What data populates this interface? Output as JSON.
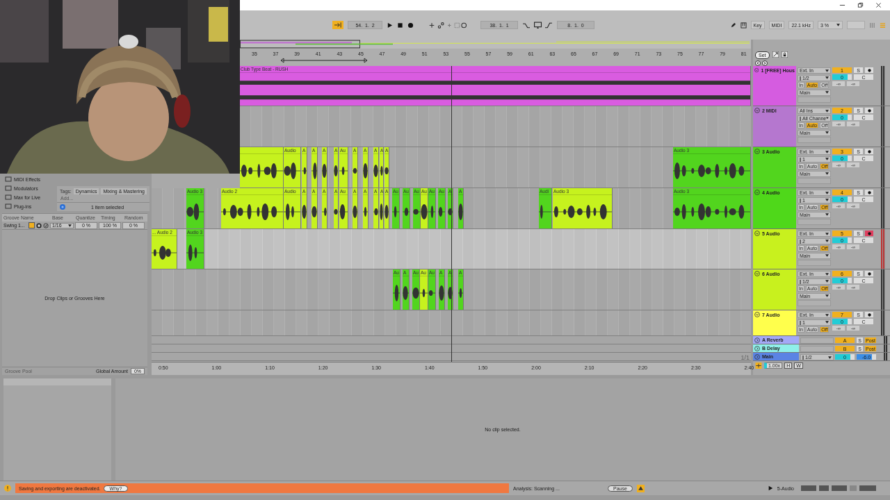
{
  "transport": {
    "follow": true,
    "position": "54.  1.  2",
    "loop_start": "38.  1.  1",
    "loop_length": "8.  1.  0"
  },
  "settings": {
    "key": "Key",
    "midi": "MIDI",
    "sample_rate": "22.1 kHz",
    "cpu": "3 %"
  },
  "ruler": {
    "bars": [
      "35",
      "37",
      "39",
      "41",
      "43",
      "45",
      "47",
      "49",
      "51",
      "53",
      "55",
      "57",
      "59",
      "61",
      "63",
      "65",
      "67",
      "69",
      "71",
      "73",
      "75",
      "77",
      "79",
      "81"
    ],
    "set": "Set"
  },
  "browser": {
    "categories": [
      "MIDI Effects",
      "Modulators",
      "Max for Live",
      "Plug-ins"
    ],
    "tags_label": "Tags:",
    "tags": [
      "Dynamics",
      "Mixing & Mastering"
    ],
    "tag_placeholder": "Add...",
    "selection": "1 item selected"
  },
  "groove_pool": {
    "columns": [
      "Groove Name",
      "Base",
      "Quantize",
      "Timing",
      "Random"
    ],
    "grooves": [
      {
        "name": "Swing 1...",
        "hot_swap": true,
        "base": "1/16",
        "quantize": "0 %",
        "timing": "100 %",
        "random": "0 %"
      }
    ],
    "hint": "Drop Clips or Grooves Here",
    "title": "Groove Pool",
    "global_amount_label": "Global Amount",
    "global_amount": "0%"
  },
  "tracks": [
    {
      "name": "1 [FREE] Hous",
      "color": "#d55ce0",
      "input": "Ext. In",
      "channel": "1/2",
      "monitor": [
        {
          "label": "In",
          "selected": false
        },
        {
          "label": "Auto",
          "selected": true
        },
        {
          "label": "Off",
          "selected": false
        }
      ],
      "output": "Main",
      "number": "1",
      "solo": "S",
      "armed": false,
      "volume": "0",
      "pan": "C",
      "peaks": [
        "-∞",
        "-∞"
      ],
      "clips": [
        {
          "name": "Club Type Beat - RUSH",
          "color": "#d95ce0"
        }
      ]
    },
    {
      "name": "2 MIDI",
      "color": "#b577cf",
      "input": "All Ins",
      "channel": "All Channe",
      "monitor": [
        {
          "label": "In",
          "selected": false
        },
        {
          "label": "Auto",
          "selected": true
        },
        {
          "label": "Off",
          "selected": false
        }
      ],
      "output": "Main",
      "number": "2",
      "solo": "S",
      "armed": false,
      "volume": "0",
      "pan": "C",
      "peaks": [
        "-∞",
        "-∞"
      ]
    },
    {
      "name": "3 Audio",
      "color": "#52d51e",
      "input": "Ext. In",
      "channel": "1",
      "monitor": [
        {
          "label": "In",
          "selected": false
        },
        {
          "label": "Auto",
          "selected": false
        },
        {
          "label": "Off",
          "selected": true
        }
      ],
      "output": "Main",
      "number": "3",
      "solo": "S",
      "armed": false,
      "volume": "0",
      "pan": "C",
      "peaks": [
        "-∞",
        "-∞"
      ],
      "clips": [
        {
          "color": "#c6f21e"
        },
        {
          "name": "Audio",
          "color": "#c6f21e"
        },
        {
          "name": "A",
          "color": "#c6f21e"
        },
        {
          "name": "A",
          "color": "#c6f21e"
        },
        {
          "name": "A",
          "color": "#c6f21e"
        },
        {
          "name": "A",
          "color": "#c6f21e"
        },
        {
          "name": "Au",
          "color": "#c6f21e"
        },
        {
          "name": "A",
          "color": "#c6f21e"
        },
        {
          "name": "A",
          "color": "#c6f21e"
        },
        {
          "name": "A",
          "color": "#c6f21e"
        },
        {
          "name": "A",
          "color": "#c6f21e"
        },
        {
          "name": "A",
          "color": "#c6f21e"
        },
        {
          "name": "Audio 3",
          "color": "#52d51e"
        }
      ]
    },
    {
      "name": "4 Audio",
      "color": "#4fd81a",
      "input": "Ext. In",
      "channel": "1",
      "monitor": [
        {
          "label": "In",
          "selected": false
        },
        {
          "label": "Auto",
          "selected": false
        },
        {
          "label": "Off",
          "selected": true
        }
      ],
      "output": "Main",
      "number": "4",
      "solo": "S",
      "armed": false,
      "volume": "0",
      "pan": "C",
      "peaks": [
        "-∞",
        "-∞"
      ],
      "clips": [
        {
          "name": "Audio 3",
          "color": "#52d51e"
        },
        {
          "name": "Audio 2",
          "color": "#c6f21e"
        },
        {
          "name": "Audio",
          "color": "#c6f21e"
        },
        {
          "name": "A",
          "color": "#c6f21e"
        },
        {
          "name": "A",
          "color": "#c6f21e"
        },
        {
          "name": "A",
          "color": "#c6f21e"
        },
        {
          "name": "A",
          "color": "#c6f21e"
        },
        {
          "name": "Au",
          "color": "#c6f21e"
        },
        {
          "name": "A",
          "color": "#c6f21e"
        },
        {
          "name": "A",
          "color": "#c6f21e"
        },
        {
          "name": "A",
          "color": "#c6f21e"
        },
        {
          "name": "A",
          "color": "#c6f21e"
        },
        {
          "name": "A",
          "color": "#c6f21e"
        },
        {
          "name": "Au",
          "color": "#52d51e"
        },
        {
          "name": "Au",
          "color": "#52d51e"
        },
        {
          "name": "Au",
          "color": "#52d51e"
        },
        {
          "name": "Au",
          "color": "#c6f21e"
        },
        {
          "name": "Au",
          "color": "#52d51e"
        },
        {
          "name": "Au",
          "color": "#52d51e"
        },
        {
          "name": "A",
          "color": "#52d51e"
        },
        {
          "name": "A",
          "color": "#52d51e"
        },
        {
          "name": "Audi",
          "color": "#52d51e"
        },
        {
          "name": "Audio 3",
          "color": "#c6f21e"
        },
        {
          "name": "Audio 3",
          "color": "#52d51e"
        }
      ]
    },
    {
      "name": "5 Audio",
      "color": "#c8f11e",
      "input": "Ext. In",
      "channel": "2",
      "monitor": [
        {
          "label": "In",
          "selected": false
        },
        {
          "label": "Auto",
          "selected": false
        },
        {
          "label": "Off",
          "selected": true
        }
      ],
      "output": "Main",
      "number": "5",
      "solo": "S",
      "armed": true,
      "volume": "0",
      "pan": "C",
      "peaks": [
        "-∞",
        "-∞"
      ],
      "clips": [
        {
          "name": "... Audio 2",
          "color": "#c6f21e"
        },
        {
          "name": "Audio 3",
          "color": "#52d51e"
        }
      ]
    },
    {
      "name": "6 Audio",
      "color": "#c8f11e",
      "input": "Ext. In",
      "channel": "1/2",
      "monitor": [
        {
          "label": "In",
          "selected": false
        },
        {
          "label": "Auto",
          "selected": false
        },
        {
          "label": "Off",
          "selected": true
        }
      ],
      "output": "Main",
      "number": "6",
      "solo": "S",
      "armed": false,
      "volume": "0",
      "pan": "C",
      "peaks": [
        "-∞",
        "-∞"
      ],
      "clips": [
        {
          "name": "Au",
          "color": "#52d51e"
        },
        {
          "name": "A",
          "color": "#52d51e"
        },
        {
          "name": "Au",
          "color": "#52d51e"
        },
        {
          "name": "Au",
          "color": "#c6f21e"
        },
        {
          "name": "Au",
          "color": "#52d51e"
        },
        {
          "name": "A",
          "color": "#52d51e"
        },
        {
          "name": "A",
          "color": "#52d51e"
        },
        {
          "name": "A",
          "color": "#52d51e"
        }
      ]
    },
    {
      "name": "7 Audio",
      "color": "#ffff4c",
      "input": "Ext. In",
      "channel": "1",
      "monitor": [
        {
          "label": "In",
          "selected": false
        },
        {
          "label": "Auto",
          "selected": false
        },
        {
          "label": "Off",
          "selected": true
        }
      ],
      "number": "7",
      "solo": "S",
      "armed": false,
      "volume": "0",
      "pan": "C",
      "peaks": [
        "-∞",
        "-∞"
      ]
    }
  ],
  "returns": [
    {
      "name": "A Reverb",
      "color": "#a4a9f7",
      "number": "A",
      "solo": "S",
      "send_mode": "Post"
    },
    {
      "name": "B Delay",
      "color": "#8ff0ea",
      "number": "B",
      "solo": "S",
      "send_mode": "Post"
    },
    {
      "name": "Main",
      "color": "#5b83e4",
      "channel": "1/2",
      "volume": "0",
      "level_reading": "-6.0"
    }
  ],
  "page": "1/1",
  "tempo_scale": "1.00x",
  "h": "H",
  "w": "W",
  "time_ruler": [
    "0:50",
    "1:00",
    "1:10",
    "1:20",
    "1:30",
    "1:40",
    "1:50",
    "2:00",
    "2:10",
    "2:20",
    "2:30",
    "2:40"
  ],
  "detail": {
    "message": "No clip selected."
  },
  "status": {
    "warning": "Saving and exporting are deactivated.",
    "why": "Why?",
    "analysis": "Analysis: Scanning ...",
    "pause": "Pause",
    "track": "5-Audio"
  }
}
